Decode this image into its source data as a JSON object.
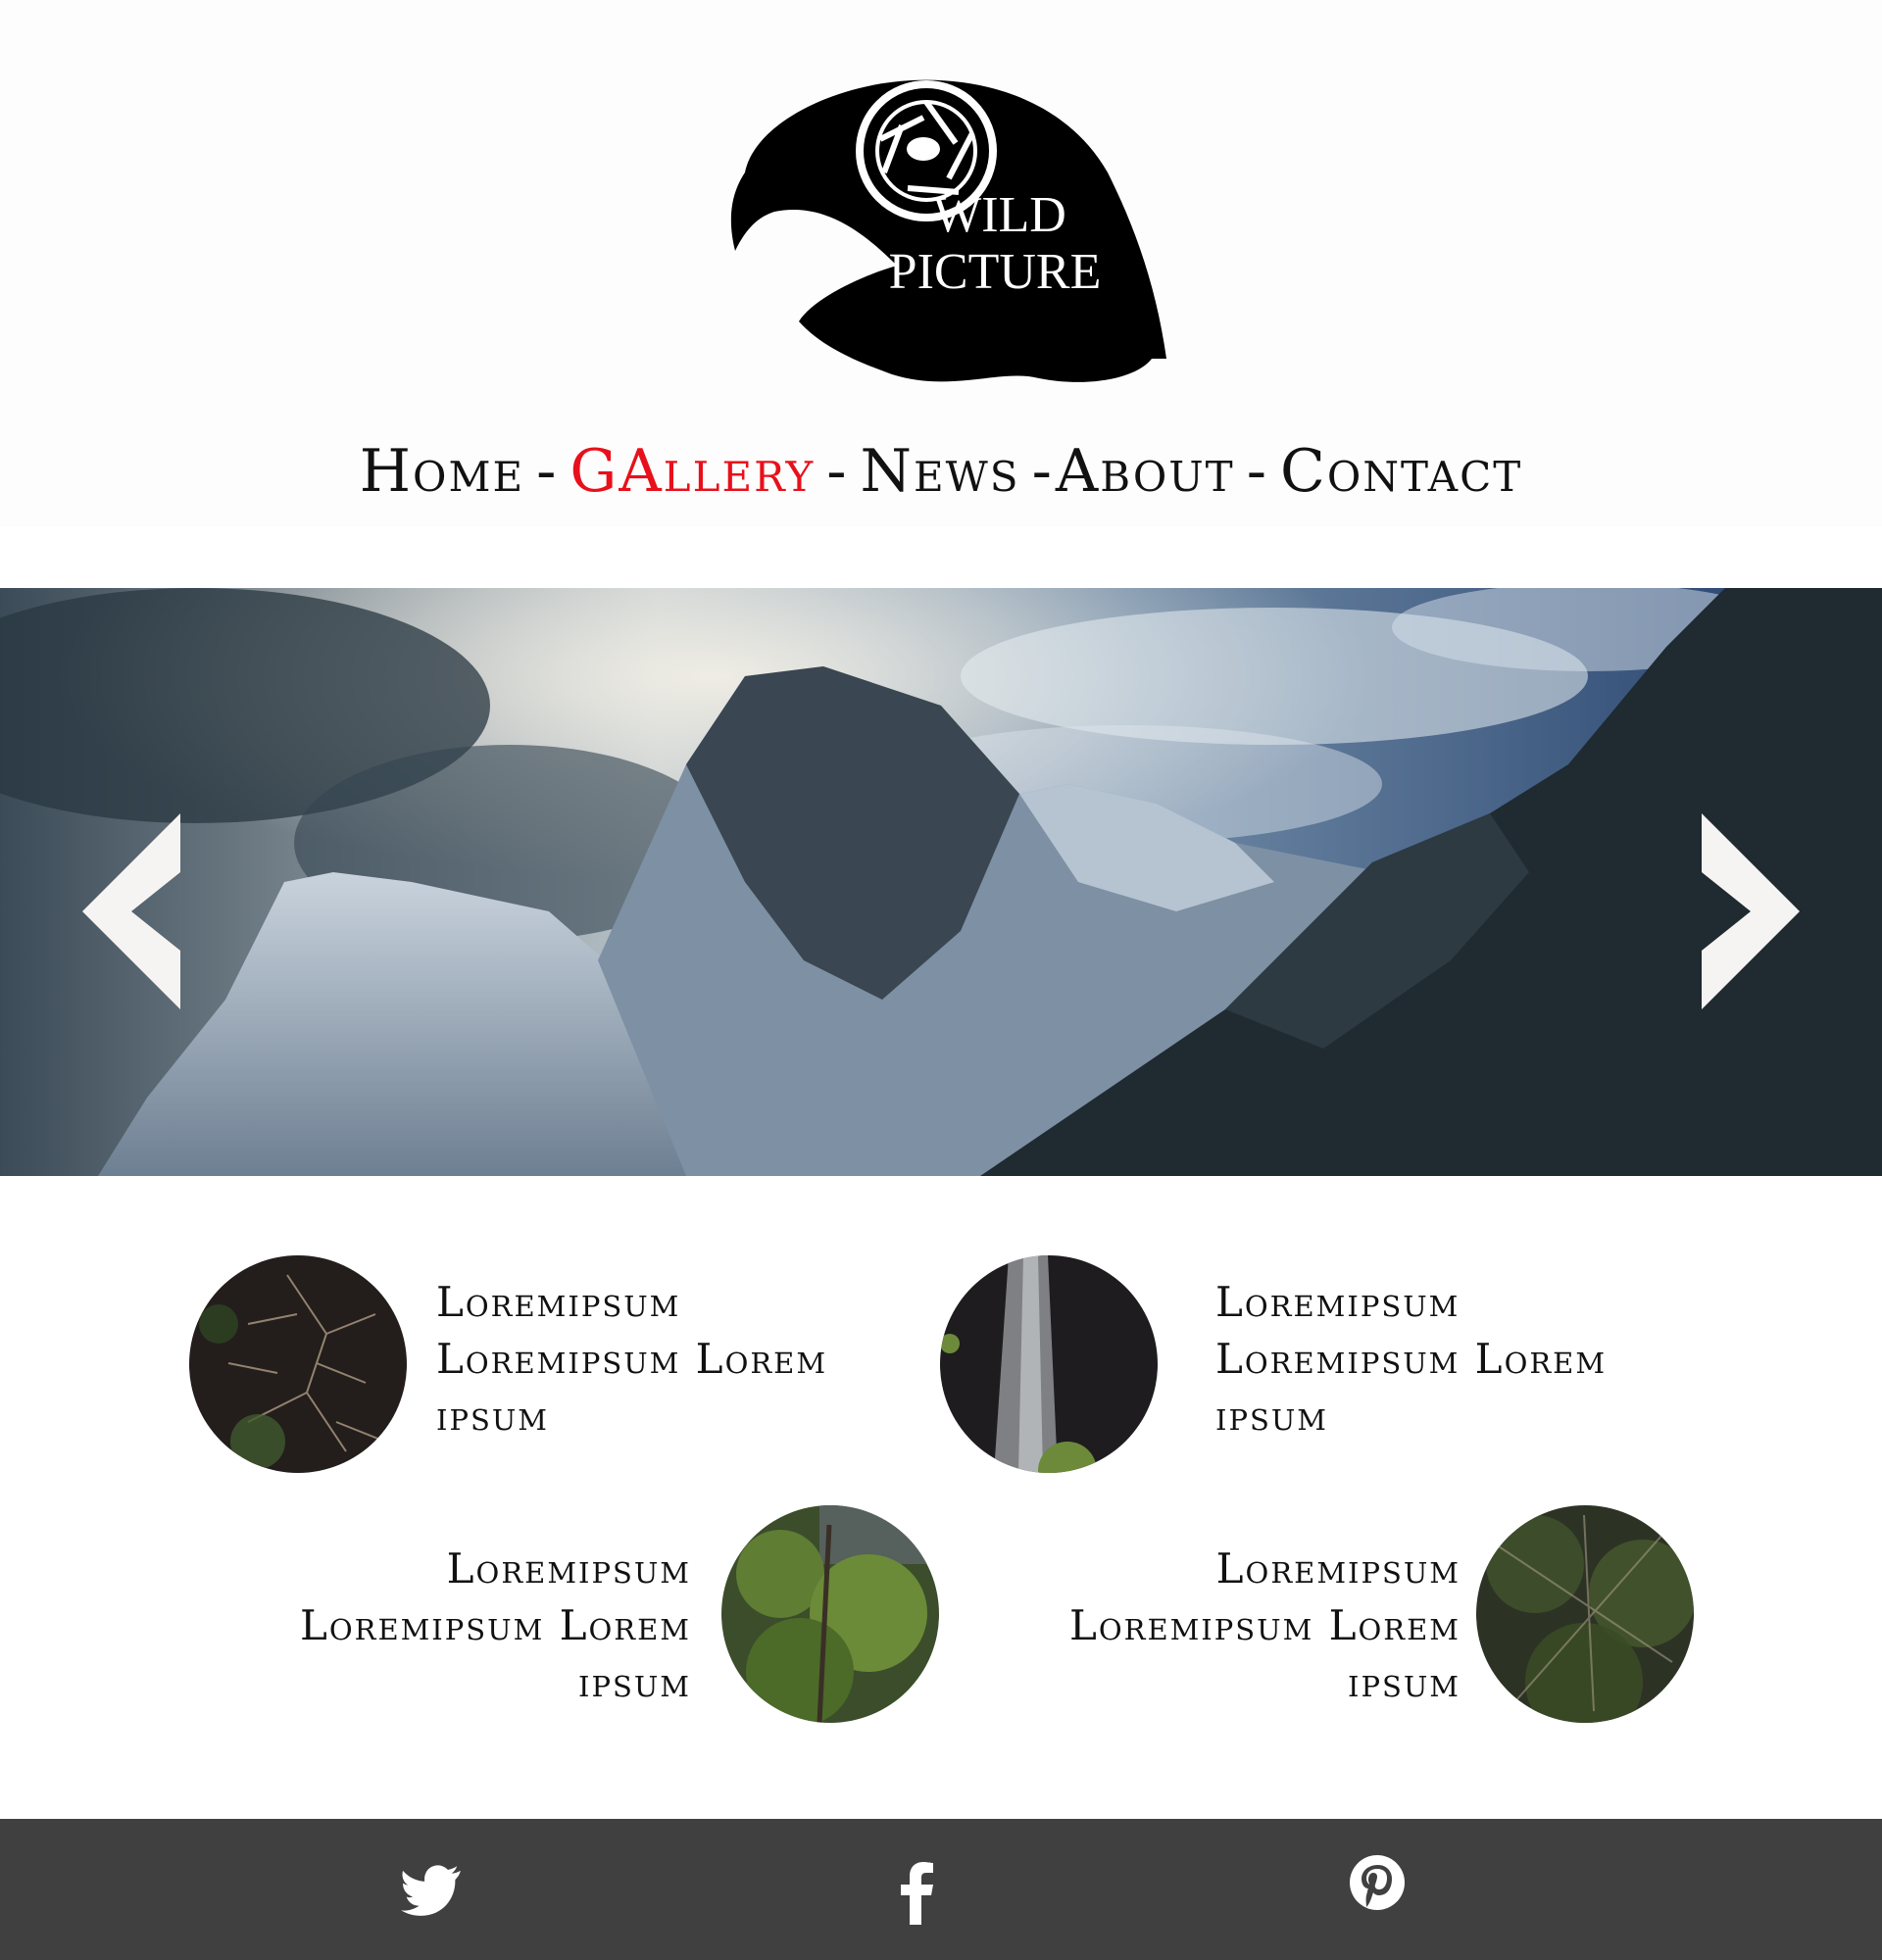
{
  "brand": {
    "line1": "WILD",
    "line2": "PICTURE",
    "accent_color": "#e8101b"
  },
  "nav": {
    "items": [
      {
        "label": "Home",
        "active": false
      },
      {
        "label": "GAllery",
        "active": true
      },
      {
        "label": "News",
        "active": false
      },
      {
        "label": "About",
        "active": false
      },
      {
        "label": "Contact",
        "active": false
      }
    ]
  },
  "hero": {
    "prev_icon": "chevron-left-icon",
    "next_icon": "chevron-right-icon"
  },
  "cards": [
    {
      "line1": "Loremipsum",
      "line2": "Loremipsum Lorem",
      "line3": "ipsum"
    },
    {
      "line1": "Loremipsum",
      "line2": "Loremipsum Lorem",
      "line3": "ipsum"
    },
    {
      "line1": "Loremipsum",
      "line2": "Loremipsum Lorem",
      "line3": "ipsum"
    },
    {
      "line1": "Loremipsum",
      "line2": "Loremipsum Lorem",
      "line3": "ipsum"
    }
  ],
  "footer": {
    "background": "#404040",
    "icons": [
      "twitter-icon",
      "facebook-icon",
      "pinterest-icon"
    ]
  }
}
